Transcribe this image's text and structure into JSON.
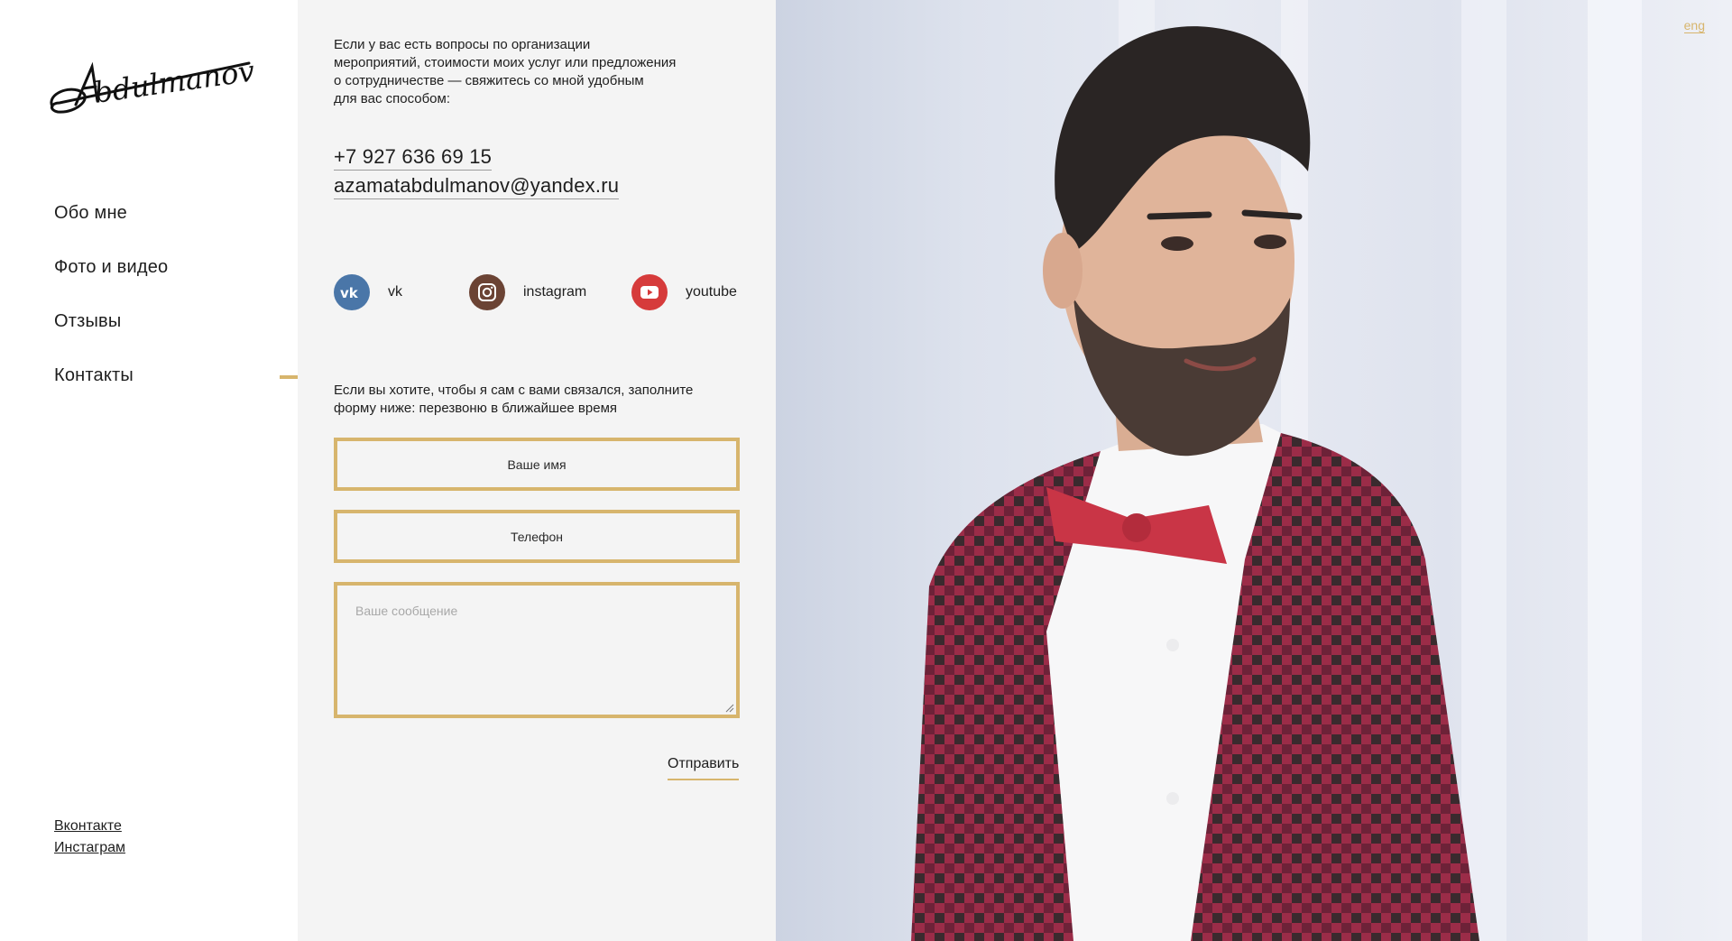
{
  "brand": {
    "logo_text": "Abdulmanov"
  },
  "nav": {
    "items": [
      {
        "label": "Обо мне"
      },
      {
        "label": "Фото и видео"
      },
      {
        "label": "Отзывы"
      },
      {
        "label": "Контакты"
      }
    ],
    "active": "Контакты"
  },
  "footer": {
    "vk": "Вконтакте",
    "instagram": "Инстаграм"
  },
  "contact": {
    "intro_lines": [
      "Если у вас есть вопросы по организации",
      "мероприятий, стоимости моих услуг или предложения",
      "о сотрудничестве — свяжитесь со мной удобным",
      "для вас способом:"
    ],
    "phone": "+7 927 636 69 15",
    "email": "azamatabdulmanov@yandex.ru",
    "socials": [
      {
        "label": "vk",
        "icon": "vk-icon",
        "color": "#4a76a8"
      },
      {
        "label": "instagram",
        "icon": "instagram-icon",
        "color": "#6b4334"
      },
      {
        "label": "youtube",
        "icon": "youtube-icon",
        "color": "#d63b3b"
      }
    ]
  },
  "form": {
    "intro_lines": [
      "Если вы хотите, чтобы я сам с вами связался, заполните",
      "форму ниже: перезвоню в ближайшее время"
    ],
    "name_placeholder": "Ваше имя",
    "phone_placeholder": "Телефон",
    "message_placeholder": "Ваше сообщение",
    "submit_label": "Отправить"
  },
  "lang_switch": "eng",
  "colors": {
    "accent": "#d7b56d",
    "panel": "#f4f4f4",
    "text": "#1e1e1e"
  }
}
